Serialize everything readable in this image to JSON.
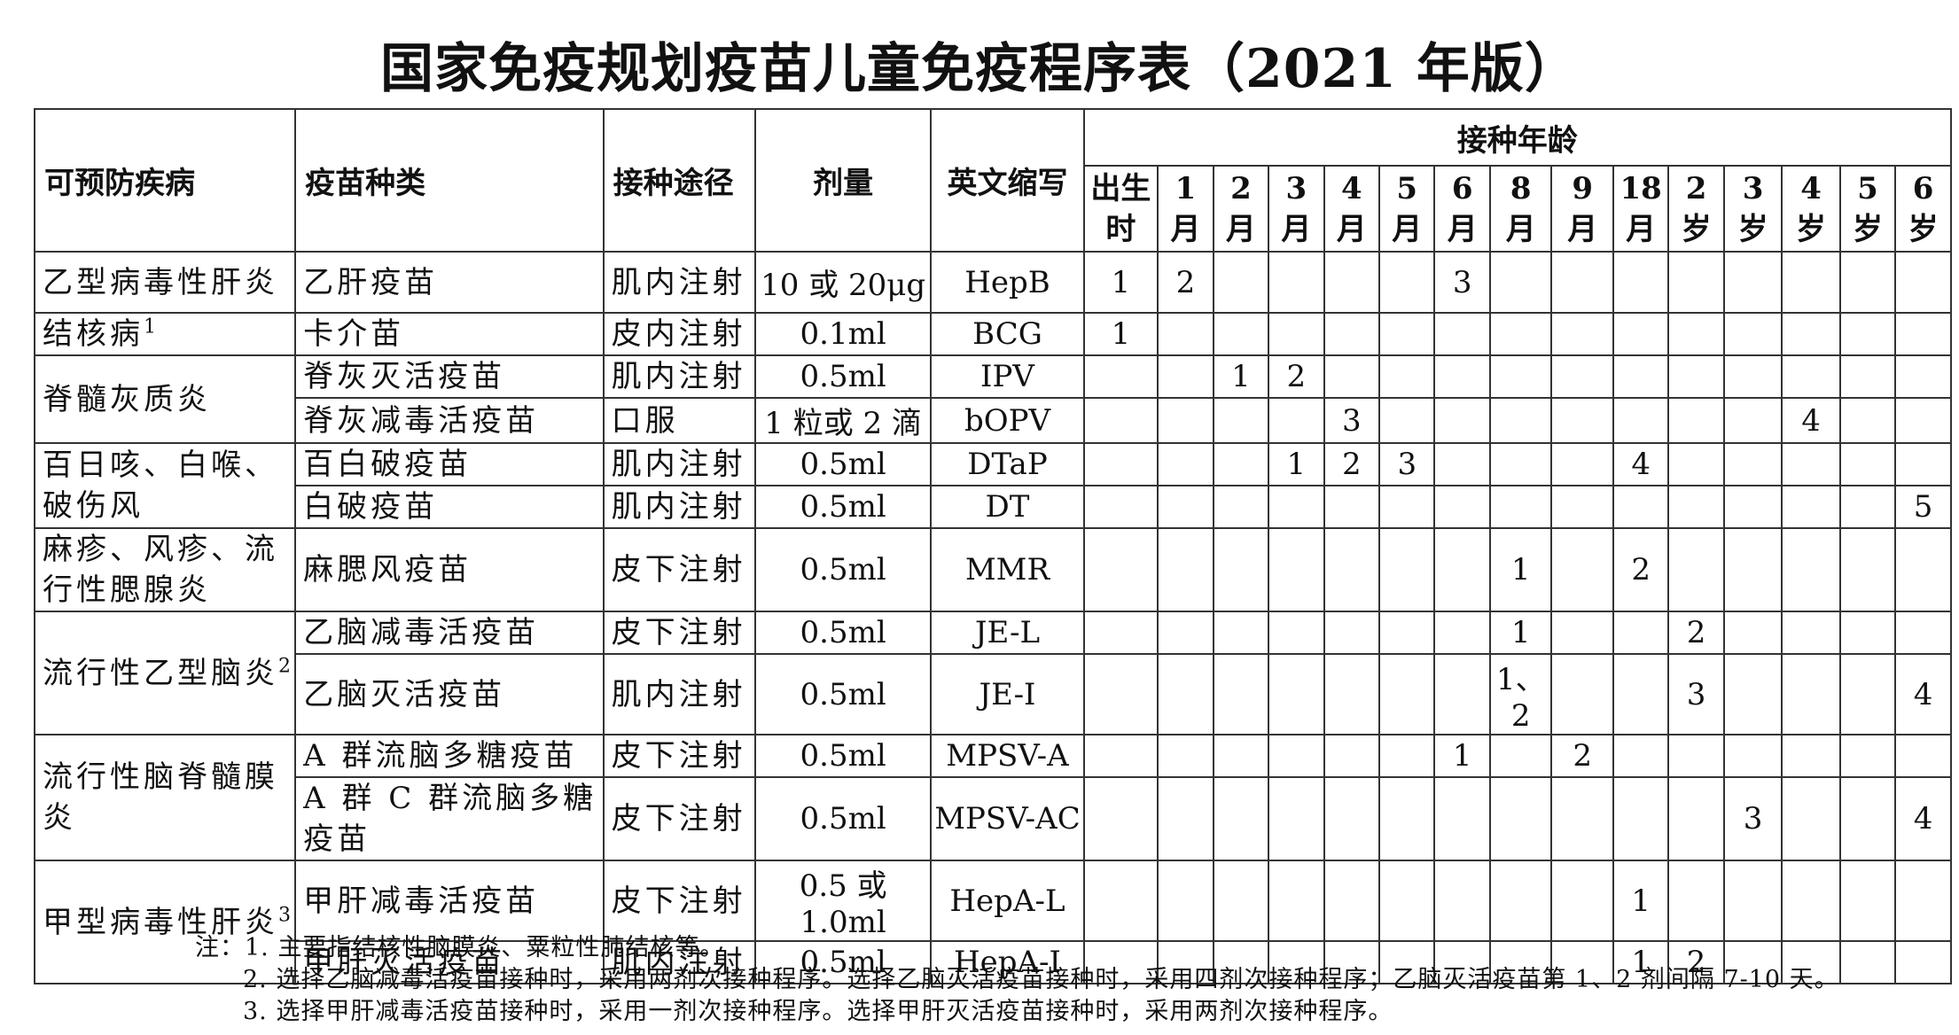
{
  "title": "国家免疫规划疫苗儿童免疫程序表（2021 年版）",
  "headers": {
    "disease": "可预防疾病",
    "vaccine": "疫苗种类",
    "route": "接种途径",
    "dose": "剂量",
    "abbr": "英文缩写",
    "age_group": "接种年龄"
  },
  "ages": [
    {
      "n": "出生",
      "u": "时"
    },
    {
      "n": "1",
      "u": "月"
    },
    {
      "n": "2",
      "u": "月"
    },
    {
      "n": "3",
      "u": "月"
    },
    {
      "n": "4",
      "u": "月"
    },
    {
      "n": "5",
      "u": "月"
    },
    {
      "n": "6",
      "u": "月"
    },
    {
      "n": "8",
      "u": "月"
    },
    {
      "n": "9",
      "u": "月"
    },
    {
      "n": "18",
      "u": "月"
    },
    {
      "n": "2",
      "u": "岁"
    },
    {
      "n": "3",
      "u": "岁"
    },
    {
      "n": "4",
      "u": "岁"
    },
    {
      "n": "5",
      "u": "岁"
    },
    {
      "n": "6",
      "u": "岁"
    }
  ],
  "diseases": [
    {
      "name": "乙型病毒性肝炎",
      "sup": ""
    },
    {
      "name": "结核病",
      "sup": "1"
    },
    {
      "name": "脊髓灰质炎",
      "sup": ""
    },
    {
      "name": "百日咳、白喉、破伤风",
      "sup": ""
    },
    {
      "name": "麻疹、风疹、流行性腮腺炎",
      "sup": ""
    },
    {
      "name": "流行性乙型脑炎",
      "sup": "2"
    },
    {
      "name": "流行性脑脊髓膜炎",
      "sup": ""
    },
    {
      "name": "甲型病毒性肝炎",
      "sup": "3"
    }
  ],
  "rows": [
    {
      "vaccine": "乙肝疫苗",
      "route": "肌内注射",
      "dose": "10 或 20μg",
      "abbr": "HepB",
      "doses": [
        "1",
        "2",
        "",
        "",
        "",
        "",
        "3",
        "",
        "",
        "",
        "",
        "",
        "",
        "",
        ""
      ]
    },
    {
      "vaccine": "卡介苗",
      "route": "皮内注射",
      "dose": "0.1ml",
      "abbr": "BCG",
      "doses": [
        "1",
        "",
        "",
        "",
        "",
        "",
        "",
        "",
        "",
        "",
        "",
        "",
        "",
        "",
        ""
      ]
    },
    {
      "vaccine": "脊灰灭活疫苗",
      "route": "肌内注射",
      "dose": "0.5ml",
      "abbr": "IPV",
      "doses": [
        "",
        "",
        "1",
        "2",
        "",
        "",
        "",
        "",
        "",
        "",
        "",
        "",
        "",
        "",
        ""
      ]
    },
    {
      "vaccine": "脊灰减毒活疫苗",
      "route": "口服",
      "dose": "1 粒或 2 滴",
      "abbr": "bOPV",
      "doses": [
        "",
        "",
        "",
        "",
        "3",
        "",
        "",
        "",
        "",
        "",
        "",
        "",
        "4",
        "",
        ""
      ]
    },
    {
      "vaccine": "百白破疫苗",
      "route": "肌内注射",
      "dose": "0.5ml",
      "abbr": "DTaP",
      "doses": [
        "",
        "",
        "",
        "1",
        "2",
        "3",
        "",
        "",
        "",
        "4",
        "",
        "",
        "",
        "",
        ""
      ]
    },
    {
      "vaccine": "白破疫苗",
      "route": "肌内注射",
      "dose": "0.5ml",
      "abbr": "DT",
      "doses": [
        "",
        "",
        "",
        "",
        "",
        "",
        "",
        "",
        "",
        "",
        "",
        "",
        "",
        "",
        "5"
      ]
    },
    {
      "vaccine": "麻腮风疫苗",
      "route": "皮下注射",
      "dose": "0.5ml",
      "abbr": "MMR",
      "doses": [
        "",
        "",
        "",
        "",
        "",
        "",
        "",
        "1",
        "",
        "2",
        "",
        "",
        "",
        "",
        ""
      ]
    },
    {
      "vaccine": "乙脑减毒活疫苗",
      "route": "皮下注射",
      "dose": "0.5ml",
      "abbr": "JE-L",
      "doses": [
        "",
        "",
        "",
        "",
        "",
        "",
        "",
        "1",
        "",
        "",
        "2",
        "",
        "",
        "",
        ""
      ]
    },
    {
      "vaccine": "乙脑灭活疫苗",
      "route": "肌内注射",
      "dose": "0.5ml",
      "abbr": "JE-I",
      "doses": [
        "",
        "",
        "",
        "",
        "",
        "",
        "",
        "1、2",
        "",
        "",
        "3",
        "",
        "",
        "",
        "4"
      ]
    },
    {
      "vaccine": "A 群流脑多糖疫苗",
      "route": "皮下注射",
      "dose": "0.5ml",
      "abbr": "MPSV-A",
      "doses": [
        "",
        "",
        "",
        "",
        "",
        "",
        "1",
        "",
        "2",
        "",
        "",
        "",
        "",
        "",
        ""
      ]
    },
    {
      "vaccine": "A 群 C 群流脑多糖疫苗",
      "route": "皮下注射",
      "dose": "0.5ml",
      "abbr": "MPSV-AC",
      "doses": [
        "",
        "",
        "",
        "",
        "",
        "",
        "",
        "",
        "",
        "",
        "",
        "3",
        "",
        "",
        "4"
      ]
    },
    {
      "vaccine": "甲肝减毒活疫苗",
      "route": "皮下注射",
      "dose": "0.5 或 1.0ml",
      "abbr": "HepA-L",
      "doses": [
        "",
        "",
        "",
        "",
        "",
        "",
        "",
        "",
        "",
        "1",
        "",
        "",
        "",
        "",
        ""
      ]
    },
    {
      "vaccine": "甲肝灭活疫苗",
      "route": "肌内注射",
      "dose": "0.5ml",
      "abbr": "HepA-I",
      "doses": [
        "",
        "",
        "",
        "",
        "",
        "",
        "",
        "",
        "",
        "1",
        "2",
        "",
        "",
        "",
        ""
      ]
    }
  ],
  "notes": [
    "注：1. 主要指结核性脑膜炎、粟粒性肺结核等。",
    "2. 选择乙脑减毒活疫苗接种时，采用两剂次接种程序。选择乙脑灭活疫苗接种时，采用四剂次接种程序；乙脑灭活疫苗第 1、2 剂间隔 7-10 天。",
    "3. 选择甲肝减毒活疫苗接种时，采用一剂次接种程序。选择甲肝灭活疫苗接种时，采用两剂次接种程序。"
  ]
}
